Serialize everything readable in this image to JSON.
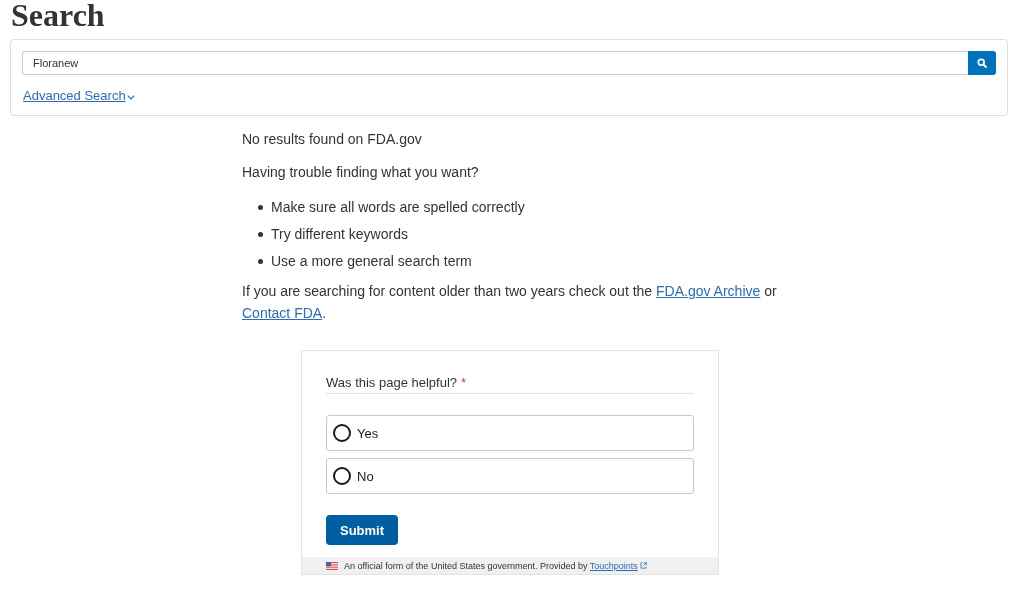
{
  "page_title": "Search",
  "search": {
    "value": "Floranew"
  },
  "advanced_search": {
    "label": "Advanced Search"
  },
  "results": {
    "message": "No results found on FDA.gov",
    "help_heading": "Having trouble finding what you want?",
    "tips": [
      "Make sure all words are spelled correctly",
      "Try different keywords",
      "Use a more general search term"
    ],
    "archive_note": {
      "text_before": "If you are searching for content older than two years check out the",
      "archive_link": "FDA.gov Archive",
      "text_between": "or",
      "contact_link": "Contact FDA",
      "text_after": "."
    }
  },
  "feedback": {
    "question": "Was this page helpful?",
    "required_mark": "*",
    "options": [
      {
        "label": "Yes",
        "selected": false
      },
      {
        "label": "No",
        "selected": false
      }
    ],
    "submit": "Submit",
    "footer": {
      "text": "An official form of the United States government. Provided by",
      "link": "Touchpoints"
    }
  }
}
